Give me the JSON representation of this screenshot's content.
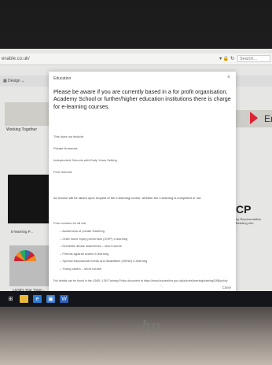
{
  "browser": {
    "url": "enable.co.uk/",
    "search_placeholder": "Search..."
  },
  "site": {
    "nav_design": "Design",
    "banner_left_caption": "Working Together",
    "photo1_caption": "E-learning P...",
    "photo2_caption": "LSAB's Year Trann...",
    "banner_right_text": "En",
    "right_logo": "CP",
    "right_small_text": "by Representative Bedding Info"
  },
  "modal": {
    "title": "Education",
    "close_symbol": "×",
    "lead": "Please be aware if you are currently based in a for profit organisation, Academy School or further/higher education institutions there is charge for e-learning courses.",
    "excludes_title": "This does not include:",
    "excludes": [
      "Private Nurseries",
      "Independent Schools with Early Years Setting",
      "Free Schools"
    ],
    "invoice_note": "An invoice will be raised upon request of the e-learning course, whether the e-learning is completed or not.",
    "free_title": "Free courses for all are:",
    "free_courses": [
      "Awareness of private fostering",
      "Child home injury prevention (CHIP) e-learning",
      "Domestic abuse awareness – short course",
      "Friends against scams e-learning",
      "Special educational needs and disabilities (SEND) e-learning",
      "Young carers – short course"
    ],
    "footer": "Full details can be found in the LSAB / LSB Training Policy document at https://www.lincolnshire.gov.uk/policies/learning/training/SAB/policy",
    "close_label": "Close"
  },
  "taskbar": {
    "icons": [
      "windows-icon",
      "file-explorer-icon",
      "edge-icon",
      "store-icon",
      "word-icon"
    ]
  },
  "device": {
    "brand": "hp"
  }
}
